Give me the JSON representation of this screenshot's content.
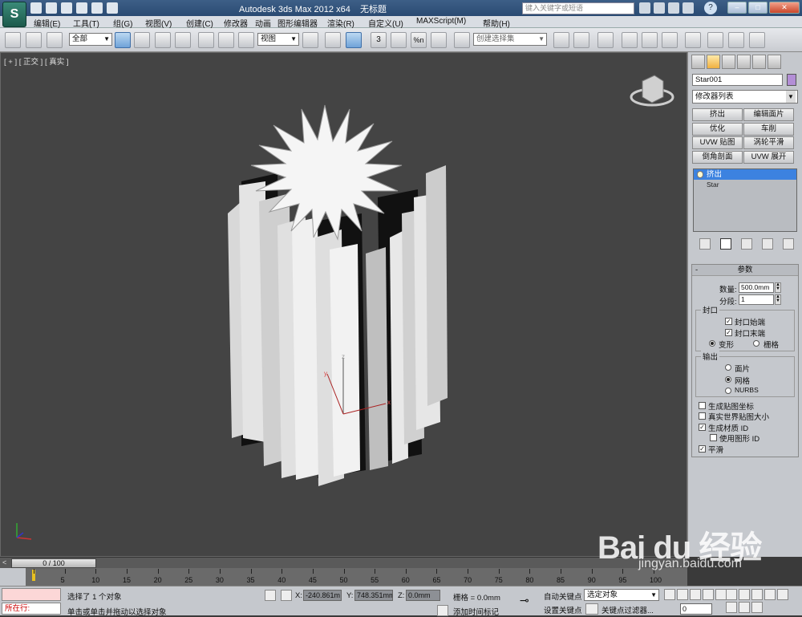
{
  "title_bar": {
    "app_icon": "3ds-max-logo",
    "title": "Autodesk 3ds Max  2012 x64",
    "document": "无标题",
    "search_placeholder": "键入关键字或短语"
  },
  "menu": [
    "编辑(E)",
    "工具(T)",
    "组(G)",
    "视图(V)",
    "创建(C)",
    "修改器",
    "动画",
    "图形编辑器",
    "渲染(R)",
    "自定义(U)",
    "MAXScript(M)",
    "帮助(H)"
  ],
  "toolbar": {
    "selection_filter": "全部",
    "reference_coord": "视图",
    "snap_label": "3",
    "percent_label": "%n",
    "named_selection": "创建选择集"
  },
  "viewport": {
    "label": "[ + ] [ 正交 ] [ 真实 ]",
    "axis_z": "z",
    "axis_y": "y",
    "axis_x": "x"
  },
  "command_panel": {
    "object_name": "Star001",
    "object_color": "#b38ed6",
    "modifier_list": "修改器列表",
    "modifier_buttons": [
      "挤出",
      "编辑面片",
      "优化",
      "车削",
      "UVW 贴图",
      "涡轮平滑",
      "倒角剖面",
      "UVW 展开"
    ],
    "stack": [
      "挤出",
      "Star"
    ],
    "params": {
      "title": "参数",
      "amount_label": "数量:",
      "amount": "500.0mm",
      "segments_label": "分段:",
      "segments": "1",
      "capping_title": "封口",
      "cap_start": "封口始端",
      "cap_end": "封口末端",
      "morph": "变形",
      "grid": "栅格",
      "output_title": "输出",
      "patch": "面片",
      "mesh": "网格",
      "nurbs": "NURBS",
      "gen_map_coords": "生成贴图坐标",
      "real_world_map": "真实世界贴图大小",
      "gen_mat_ids": "生成材质 ID",
      "use_shape_ids": "使用图形 ID",
      "smooth": "平滑"
    }
  },
  "timeline": {
    "frame": "0 / 100",
    "ticks": [
      "0",
      "5",
      "10",
      "15",
      "20",
      "25",
      "30",
      "35",
      "40",
      "45",
      "50",
      "55",
      "60",
      "65",
      "70",
      "75",
      "80",
      "85",
      "90",
      "95",
      "100"
    ]
  },
  "status": {
    "script_prompt": "所在行:",
    "selected": "选择了 1 个对象",
    "prompt": "单击或单击并拖动以选择对象",
    "x_label": "X:",
    "x": "-240.861m",
    "y_label": "Y:",
    "y": "748.351mm",
    "z_label": "Z:",
    "z": "0.0mm",
    "grid": "栅格 = 0.0mm",
    "add_time_tag": "添加时间标记",
    "auto_key": "自动关键点",
    "set_key": "设置关键点",
    "key_mode": "选定对象",
    "key_filters": "关键点过滤器...",
    "frame_field": "0"
  },
  "watermark": {
    "brand": "Bai du 经验",
    "url": "jingyan.baidu.com"
  }
}
